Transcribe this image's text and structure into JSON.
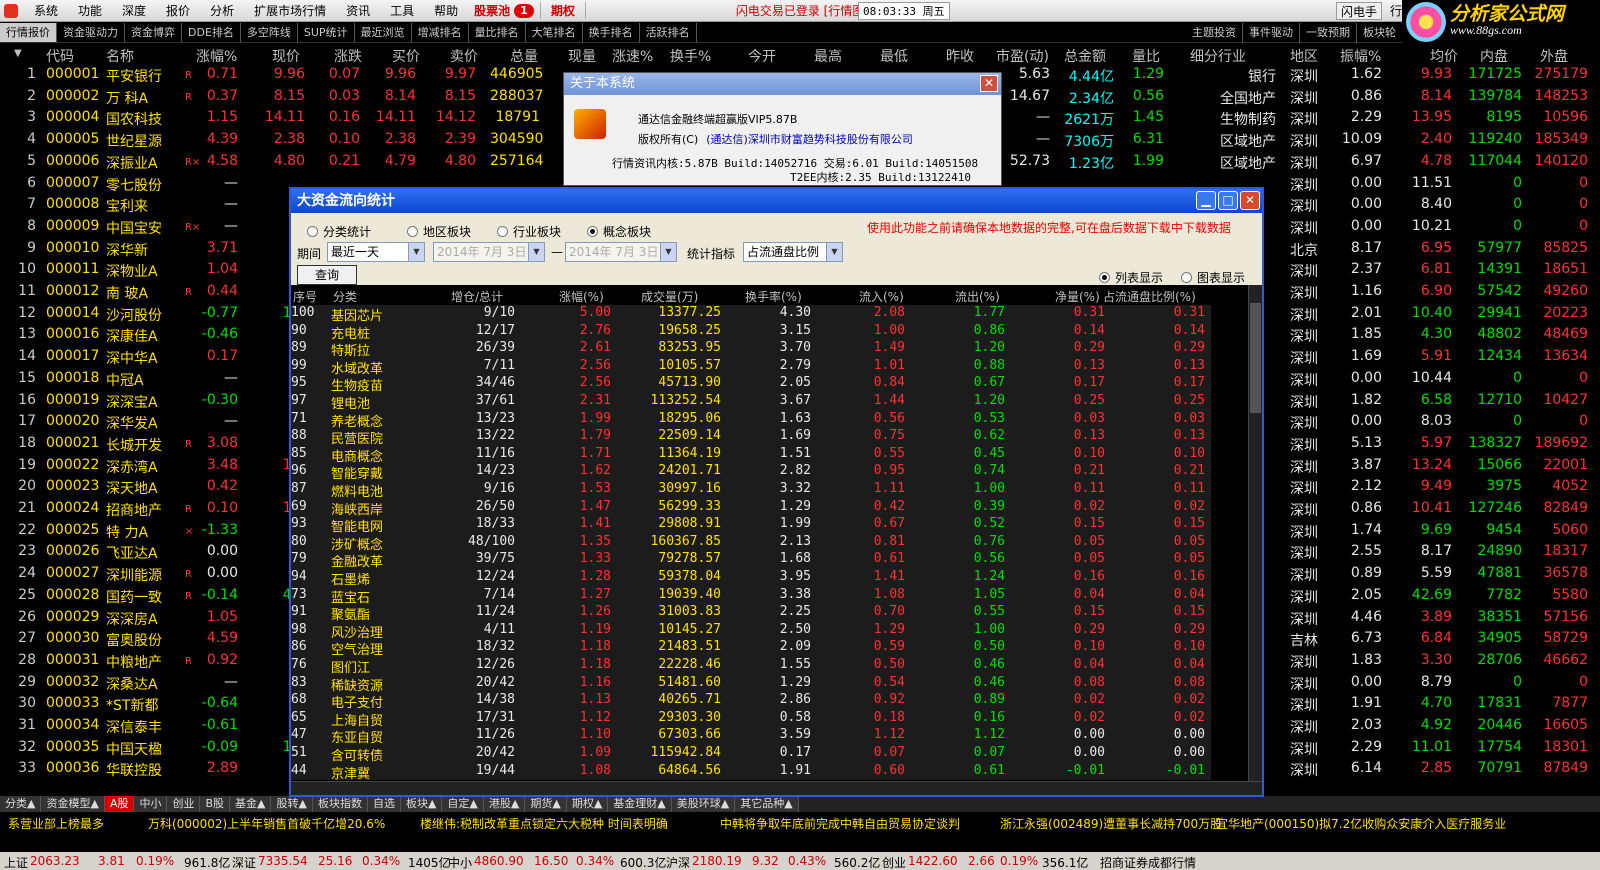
{
  "menubar": {
    "items": [
      "系统",
      "功能",
      "深度",
      "报价",
      "分析",
      "扩展市场行情",
      "资讯",
      "工具",
      "帮助"
    ],
    "pool": "股票池",
    "pool_badge": "1",
    "period": "期权",
    "status": "闪电交易已登录  [行情图-深沪A股]",
    "time": "08:03:33 周五",
    "flash": "闪电手",
    "extra": "行"
  },
  "logo": {
    "text": "分析家公式网",
    "url": "www.88gs.com"
  },
  "tabs": [
    "行情报价",
    "资金驱动力",
    "资金博弈",
    "DDE排名",
    "多空阵线",
    "SUP统计",
    "最近浏览",
    "增减排名",
    "量比排名",
    "大笔排名",
    "换手排名",
    "活跃排名"
  ],
  "tabs_right": [
    "主题投资",
    "事件驱动",
    "一致预期",
    "板块轮"
  ],
  "header": [
    "代码",
    "名称",
    "涨幅%",
    "现价",
    "涨跌",
    "买价",
    "卖价",
    "总量",
    "现量",
    "涨速%",
    "换手%",
    "今开",
    "最高",
    "最低",
    "昨收",
    "市盈(动)",
    "总金额",
    "量比",
    "细分行业",
    "地区",
    "振幅%",
    "均价",
    "内盘",
    "外盘"
  ],
  "rows": [
    {
      "i": "1",
      "code": "000001",
      "name": "平安银行",
      "m": "R",
      "chg": "0.71",
      "price": "9.96",
      "d": "0.07",
      "bid": "9.96",
      "ask": "9.97",
      "vol": "446905",
      "pe": "5.63",
      "amt": "4.44亿",
      "qr": "1.29",
      "ind": "银行",
      "reg": "深圳",
      "amp": "1.62",
      "avg": "9.93",
      "inv": "171725",
      "outv": "275179"
    },
    {
      "i": "2",
      "code": "000002",
      "name": "万  科A",
      "m": "R",
      "chg": "0.37",
      "price": "8.15",
      "d": "0.03",
      "bid": "8.14",
      "ask": "8.15",
      "vol": "288037",
      "pe": "14.67",
      "amt": "2.34亿",
      "qr": "0.56",
      "ind": "全国地产",
      "reg": "深圳",
      "amp": "0.86",
      "avg": "8.14",
      "inv": "139784",
      "outv": "148253"
    },
    {
      "i": "3",
      "code": "000004",
      "name": "国农科技",
      "m": "",
      "chg": "1.15",
      "price": "14.11",
      "d": "0.16",
      "bid": "14.11",
      "ask": "14.12",
      "vol": "18791",
      "pe": "—",
      "amt": "2621万",
      "qr": "1.45",
      "ind": "生物制药",
      "reg": "深圳",
      "amp": "2.29",
      "avg": "13.95",
      "inv": "8195",
      "outv": "10596"
    },
    {
      "i": "4",
      "code": "000005",
      "name": "世纪星源",
      "m": "",
      "chg": "4.39",
      "price": "2.38",
      "d": "0.10",
      "bid": "2.38",
      "ask": "2.39",
      "vol": "304590",
      "pe": "—",
      "amt": "7306万",
      "qr": "6.31",
      "ind": "区域地产",
      "reg": "深圳",
      "amp": "10.09",
      "avg": "2.40",
      "inv": "119240",
      "outv": "185349"
    },
    {
      "i": "5",
      "code": "000006",
      "name": "深振业A",
      "m": "R×",
      "chg": "4.58",
      "price": "4.80",
      "d": "0.21",
      "bid": "4.79",
      "ask": "4.80",
      "vol": "257164",
      "pe": "52.73",
      "amt": "1.23亿",
      "qr": "1.99",
      "ind": "区域地产",
      "reg": "深圳",
      "amp": "6.97",
      "avg": "4.78",
      "inv": "117044",
      "outv": "140120"
    },
    {
      "i": "6",
      "code": "000007",
      "name": "零七股份",
      "m": "",
      "chg": "—",
      "price": "",
      "d": "",
      "bid": "",
      "ask": "",
      "vol": "",
      "pe": "",
      "amt": "",
      "qr": "",
      "ind": "",
      "reg": "深圳",
      "amp": "0.00",
      "avg": "11.51",
      "inv": "0",
      "outv": "0"
    },
    {
      "i": "7",
      "code": "000008",
      "name": "宝利来",
      "m": "",
      "chg": "—",
      "price": "",
      "d": "",
      "bid": "",
      "ask": "",
      "vol": "",
      "pe": "",
      "amt": "",
      "qr": "",
      "ind": "",
      "reg": "深圳",
      "amp": "0.00",
      "avg": "8.40",
      "inv": "0",
      "outv": "0"
    },
    {
      "i": "8",
      "code": "000009",
      "name": "中国宝安",
      "m": "R×",
      "chg": "—",
      "price": "",
      "d": "",
      "bid": "",
      "ask": "",
      "vol": "",
      "pe": "",
      "amt": "",
      "qr": "",
      "ind": "",
      "reg": "深圳",
      "amp": "0.00",
      "avg": "10.21",
      "inv": "0",
      "outv": "0"
    },
    {
      "i": "9",
      "code": "000010",
      "name": "深华新",
      "m": "",
      "chg": "3.71",
      "price": "6.",
      "d": "",
      "bid": "",
      "ask": "",
      "vol": "",
      "pe": "",
      "amt": "",
      "qr": "",
      "ind": "",
      "reg": "北京",
      "amp": "8.17",
      "avg": "6.95",
      "inv": "57977",
      "outv": "85825"
    },
    {
      "i": "10",
      "code": "000011",
      "name": "深物业A",
      "m": "",
      "chg": "1.04",
      "price": "6.",
      "d": "",
      "bid": "",
      "ask": "",
      "vol": "",
      "pe": "",
      "amt": "",
      "qr": "",
      "ind": "",
      "reg": "深圳",
      "amp": "2.37",
      "avg": "6.81",
      "inv": "14391",
      "outv": "18651"
    },
    {
      "i": "11",
      "code": "000012",
      "name": "南  玻A",
      "m": "R",
      "chg": "0.44",
      "price": "6.",
      "d": "",
      "bid": "",
      "ask": "",
      "vol": "",
      "pe": "",
      "amt": "",
      "qr": "",
      "ind": "",
      "reg": "深圳",
      "amp": "1.16",
      "avg": "6.90",
      "inv": "57542",
      "outv": "49260"
    },
    {
      "i": "12",
      "code": "000014",
      "name": "沙河股份",
      "m": "",
      "chg": "-0.77",
      "price": "10.",
      "d": "",
      "bid": "",
      "ask": "",
      "vol": "",
      "pe": "",
      "amt": "",
      "qr": "",
      "ind": "",
      "reg": "深圳",
      "amp": "2.01",
      "avg": "10.40",
      "inv": "29941",
      "outv": "20223"
    },
    {
      "i": "13",
      "code": "000016",
      "name": "深康佳A",
      "m": "",
      "chg": "-0.46",
      "price": "4.",
      "d": "",
      "bid": "",
      "ask": "",
      "vol": "",
      "pe": "",
      "amt": "",
      "qr": "",
      "ind": "",
      "reg": "深圳",
      "amp": "1.85",
      "avg": "4.30",
      "inv": "48802",
      "outv": "48469"
    },
    {
      "i": "14",
      "code": "000017",
      "name": "深中华A",
      "m": "",
      "chg": "0.17",
      "price": "5.",
      "d": "",
      "bid": "",
      "ask": "",
      "vol": "",
      "pe": "",
      "amt": "",
      "qr": "",
      "ind": "",
      "reg": "深圳",
      "amp": "1.69",
      "avg": "5.91",
      "inv": "12434",
      "outv": "13634"
    },
    {
      "i": "15",
      "code": "000018",
      "name": "中冠A",
      "m": "",
      "chg": "—",
      "price": "",
      "d": "",
      "bid": "",
      "ask": "",
      "vol": "",
      "pe": "",
      "amt": "",
      "qr": "",
      "ind": "",
      "reg": "深圳",
      "amp": "0.00",
      "avg": "10.44",
      "inv": "0",
      "outv": "0"
    },
    {
      "i": "16",
      "code": "000019",
      "name": "深深宝A",
      "m": "",
      "chg": "-0.30",
      "price": "6.",
      "d": "",
      "bid": "",
      "ask": "",
      "vol": "",
      "pe": "",
      "amt": "",
      "qr": "",
      "ind": "",
      "reg": "深圳",
      "amp": "1.82",
      "avg": "6.58",
      "inv": "12710",
      "outv": "10427"
    },
    {
      "i": "17",
      "code": "000020",
      "name": "深华发A",
      "m": "",
      "chg": "—",
      "price": "",
      "d": "",
      "bid": "",
      "ask": "",
      "vol": "",
      "pe": "",
      "amt": "",
      "qr": "",
      "ind": "",
      "reg": "深圳",
      "amp": "0.00",
      "avg": "8.03",
      "inv": "0",
      "outv": "0"
    },
    {
      "i": "18",
      "code": "000021",
      "name": "长城开发",
      "m": "R",
      "chg": "3.08",
      "price": "6.",
      "d": "",
      "bid": "",
      "ask": "",
      "vol": "",
      "pe": "",
      "amt": "",
      "qr": "",
      "ind": "",
      "reg": "深圳",
      "amp": "5.13",
      "avg": "5.97",
      "inv": "138327",
      "outv": "189692"
    },
    {
      "i": "19",
      "code": "000022",
      "name": "深赤湾A",
      "m": "",
      "chg": "3.48",
      "price": "13.",
      "d": "",
      "bid": "",
      "ask": "",
      "vol": "",
      "pe": "",
      "amt": "",
      "qr": "",
      "ind": "",
      "reg": "深圳",
      "amp": "3.87",
      "avg": "13.24",
      "inv": "15066",
      "outv": "22001"
    },
    {
      "i": "20",
      "code": "000023",
      "name": "深天地A",
      "m": "",
      "chg": "0.42",
      "price": "9.",
      "d": "",
      "bid": "",
      "ask": "",
      "vol": "",
      "pe": "",
      "amt": "",
      "qr": "",
      "ind": "",
      "reg": "深圳",
      "amp": "2.12",
      "avg": "9.49",
      "inv": "3975",
      "outv": "4052"
    },
    {
      "i": "21",
      "code": "000024",
      "name": "招商地产",
      "m": "R",
      "chg": "0.10",
      "price": "10.",
      "d": "",
      "bid": "",
      "ask": "",
      "vol": "",
      "pe": "",
      "amt": "",
      "qr": "",
      "ind": "",
      "reg": "深圳",
      "amp": "0.86",
      "avg": "10.41",
      "inv": "127246",
      "outv": "82849"
    },
    {
      "i": "22",
      "code": "000025",
      "name": "特  力A",
      "m": "×",
      "chg": "-1.33",
      "price": "9.",
      "d": "",
      "bid": "",
      "ask": "",
      "vol": "",
      "pe": "",
      "amt": "",
      "qr": "",
      "ind": "",
      "reg": "深圳",
      "amp": "1.74",
      "avg": "9.69",
      "inv": "9454",
      "outv": "5060"
    },
    {
      "i": "23",
      "code": "000026",
      "name": "飞亚达A",
      "m": "",
      "chg": "0.00",
      "price": "8.",
      "d": "",
      "bid": "",
      "ask": "",
      "vol": "",
      "pe": "",
      "amt": "",
      "qr": "",
      "ind": "",
      "reg": "深圳",
      "amp": "2.55",
      "avg": "8.17",
      "inv": "24890",
      "outv": "18317"
    },
    {
      "i": "24",
      "code": "000027",
      "name": "深圳能源",
      "m": "R",
      "chg": "0.00",
      "price": "5.",
      "d": "",
      "bid": "",
      "ask": "",
      "vol": "",
      "pe": "",
      "amt": "",
      "qr": "",
      "ind": "",
      "reg": "深圳",
      "amp": "0.89",
      "avg": "5.59",
      "inv": "47881",
      "outv": "36578"
    },
    {
      "i": "25",
      "code": "000028",
      "name": "国药一致",
      "m": "R",
      "chg": "-0.14",
      "price": "42.",
      "d": "",
      "bid": "",
      "ask": "",
      "vol": "",
      "pe": "",
      "amt": "",
      "qr": "",
      "ind": "",
      "reg": "深圳",
      "amp": "2.05",
      "avg": "42.69",
      "inv": "7782",
      "outv": "5580"
    },
    {
      "i": "26",
      "code": "000029",
      "name": "深深房A",
      "m": "",
      "chg": "1.05",
      "price": "3.",
      "d": "",
      "bid": "",
      "ask": "",
      "vol": "",
      "pe": "",
      "amt": "",
      "qr": "",
      "ind": "",
      "reg": "深圳",
      "amp": "4.46",
      "avg": "3.89",
      "inv": "38351",
      "outv": "57156"
    },
    {
      "i": "27",
      "code": "000030",
      "name": "富奥股份",
      "m": "",
      "chg": "4.59",
      "price": "6.",
      "d": "",
      "bid": "",
      "ask": "",
      "vol": "",
      "pe": "",
      "amt": "",
      "qr": "",
      "ind": "",
      "reg": "吉林",
      "amp": "6.73",
      "avg": "6.84",
      "inv": "34905",
      "outv": "58729"
    },
    {
      "i": "28",
      "code": "000031",
      "name": "中粮地产",
      "m": "R",
      "chg": "0.92",
      "price": "3.",
      "d": "",
      "bid": "",
      "ask": "",
      "vol": "",
      "pe": "",
      "amt": "",
      "qr": "",
      "ind": "",
      "reg": "深圳",
      "amp": "1.83",
      "avg": "3.30",
      "inv": "28706",
      "outv": "46662"
    },
    {
      "i": "29",
      "code": "000032",
      "name": "深桑达A",
      "m": "",
      "chg": "—",
      "price": "",
      "d": "",
      "bid": "",
      "ask": "",
      "vol": "",
      "pe": "",
      "amt": "",
      "qr": "",
      "ind": "",
      "reg": "深圳",
      "amp": "0.00",
      "avg": "8.79",
      "inv": "0",
      "outv": "0"
    },
    {
      "i": "30",
      "code": "000033",
      "name": "*ST新都",
      "m": "",
      "chg": "-0.64",
      "price": "4.",
      "d": "",
      "bid": "",
      "ask": "",
      "vol": "",
      "pe": "",
      "amt": "",
      "qr": "",
      "ind": "",
      "reg": "深圳",
      "amp": "1.91",
      "avg": "4.70",
      "inv": "17831",
      "outv": "7877"
    },
    {
      "i": "31",
      "code": "000034",
      "name": "深信泰丰",
      "m": "",
      "chg": "-0.61",
      "price": "4.",
      "d": "",
      "bid": "",
      "ask": "",
      "vol": "",
      "pe": "",
      "amt": "",
      "qr": "",
      "ind": "",
      "reg": "深圳",
      "amp": "2.03",
      "avg": "4.92",
      "inv": "20446",
      "outv": "16605"
    },
    {
      "i": "32",
      "code": "000035",
      "name": "中国天楹",
      "m": "",
      "chg": "-0.09",
      "price": "10.",
      "d": "",
      "bid": "",
      "ask": "",
      "vol": "",
      "pe": "",
      "amt": "",
      "qr": "",
      "ind": "",
      "reg": "深圳",
      "amp": "2.29",
      "avg": "11.01",
      "inv": "17754",
      "outv": "18301"
    },
    {
      "i": "33",
      "code": "000036",
      "name": "华联控股",
      "m": "",
      "chg": "2.89",
      "price": "2.",
      "d": "",
      "bid": "",
      "ask": "",
      "vol": "",
      "pe": "",
      "amt": "",
      "qr": "",
      "ind": "",
      "reg": "深圳",
      "amp": "6.14",
      "avg": "2.85",
      "inv": "70791",
      "outv": "87849"
    }
  ],
  "about": {
    "title": "关于本系统",
    "line1": "通达信金融终端超赢版VIP5.87B",
    "line2": "版权所有(C)",
    "company": "(通达信)深圳市财富趋势科技股份有限公司",
    "line3": "行情资讯内核:5.87B Build:14052716 交易:6.01 Build:14051508",
    "line4": "T2EE内核:2.35 Build:13122410"
  },
  "flow": {
    "title": "大资金流向统计",
    "radios": [
      "分类统计",
      "地区板块",
      "行业板块",
      "概念板块"
    ],
    "warn": "使用此功能之前请确保本地数据的完整,可在盘后数据下载中下载数据",
    "period_label": "期间",
    "period_value": "最近一天",
    "date1": "2014年 7月 3日",
    "date2": "2014年 7月 3日",
    "dash": "—",
    "stat_label": "统计指标",
    "stat_value": "占流通盘比例",
    "query": "查询",
    "view_list": "列表显示",
    "view_chart": "图表显示",
    "cols": [
      "序号",
      "分类",
      "增仓/总计",
      "涨幅(%)",
      "成交量(万)",
      "换手率(%)",
      "流入(%)",
      "流出(%)",
      "净量(%)",
      "占流通盘比例(%)"
    ],
    "rows": [
      [
        "100",
        "基因芯片",
        "9/10",
        "5.00",
        "13377.25",
        "4.30",
        "2.08",
        "1.77",
        "0.31",
        "0.31"
      ],
      [
        "90",
        "充电桩",
        "12/17",
        "2.76",
        "19658.25",
        "3.15",
        "1.00",
        "0.86",
        "0.14",
        "0.14"
      ],
      [
        "89",
        "特斯拉",
        "26/39",
        "2.61",
        "83253.95",
        "3.70",
        "1.49",
        "1.20",
        "0.29",
        "0.29"
      ],
      [
        "99",
        "水域改革",
        "7/11",
        "2.56",
        "10105.57",
        "2.79",
        "1.01",
        "0.88",
        "0.13",
        "0.13"
      ],
      [
        "95",
        "生物疫苗",
        "34/46",
        "2.56",
        "45713.90",
        "2.05",
        "0.84",
        "0.67",
        "0.17",
        "0.17"
      ],
      [
        "97",
        "锂电池",
        "37/61",
        "2.31",
        "113252.54",
        "3.67",
        "1.44",
        "1.20",
        "0.25",
        "0.25"
      ],
      [
        "71",
        "养老概念",
        "13/23",
        "1.99",
        "18295.06",
        "1.63",
        "0.56",
        "0.53",
        "0.03",
        "0.03"
      ],
      [
        "88",
        "民营医院",
        "13/22",
        "1.79",
        "22509.14",
        "1.69",
        "0.75",
        "0.62",
        "0.13",
        "0.13"
      ],
      [
        "85",
        "电商概念",
        "11/16",
        "1.71",
        "11364.19",
        "1.51",
        "0.55",
        "0.45",
        "0.10",
        "0.10"
      ],
      [
        "96",
        "智能穿戴",
        "14/23",
        "1.62",
        "24201.71",
        "2.82",
        "0.95",
        "0.74",
        "0.21",
        "0.21"
      ],
      [
        "87",
        "燃料电池",
        "9/16",
        "1.53",
        "30997.16",
        "3.32",
        "1.11",
        "1.00",
        "0.11",
        "0.11"
      ],
      [
        "69",
        "海峡西岸",
        "26/50",
        "1.47",
        "56299.33",
        "1.29",
        "0.42",
        "0.39",
        "0.02",
        "0.02"
      ],
      [
        "93",
        "智能电网",
        "18/33",
        "1.41",
        "29808.91",
        "1.99",
        "0.67",
        "0.52",
        "0.15",
        "0.15"
      ],
      [
        "80",
        "涉矿概念",
        "48/100",
        "1.35",
        "160367.85",
        "2.13",
        "0.81",
        "0.76",
        "0.05",
        "0.05"
      ],
      [
        "79",
        "金融改革",
        "39/75",
        "1.33",
        "79278.57",
        "1.68",
        "0.61",
        "0.56",
        "0.05",
        "0.05"
      ],
      [
        "94",
        "石墨烯",
        "12/24",
        "1.28",
        "59378.04",
        "3.95",
        "1.41",
        "1.24",
        "0.16",
        "0.16"
      ],
      [
        "73",
        "蓝宝石",
        "7/14",
        "1.27",
        "19039.40",
        "3.38",
        "1.08",
        "1.05",
        "0.04",
        "0.04"
      ],
      [
        "91",
        "聚氨酯",
        "11/24",
        "1.26",
        "31003.83",
        "2.25",
        "0.70",
        "0.55",
        "0.15",
        "0.15"
      ],
      [
        "98",
        "风沙治理",
        "4/11",
        "1.19",
        "10145.27",
        "2.50",
        "1.29",
        "1.00",
        "0.29",
        "0.29"
      ],
      [
        "86",
        "空气治理",
        "18/32",
        "1.18",
        "21483.51",
        "2.09",
        "0.59",
        "0.50",
        "0.10",
        "0.10"
      ],
      [
        "76",
        "图们江",
        "12/26",
        "1.18",
        "22228.46",
        "1.55",
        "0.50",
        "0.46",
        "0.04",
        "0.04"
      ],
      [
        "83",
        "稀缺资源",
        "20/42",
        "1.16",
        "51481.60",
        "1.29",
        "0.54",
        "0.46",
        "0.08",
        "0.08"
      ],
      [
        "68",
        "电子支付",
        "14/38",
        "1.13",
        "40265.71",
        "2.86",
        "0.92",
        "0.89",
        "0.02",
        "0.02"
      ],
      [
        "65",
        "上海自贸",
        "17/31",
        "1.12",
        "29303.30",
        "0.58",
        "0.18",
        "0.16",
        "0.02",
        "0.02"
      ],
      [
        "47",
        "东亚自贸",
        "11/26",
        "1.10",
        "67303.66",
        "3.59",
        "1.12",
        "1.12",
        "0.00",
        "0.00"
      ],
      [
        "51",
        "含可转债",
        "20/42",
        "1.09",
        "115942.84",
        "0.17",
        "0.07",
        "0.07",
        "0.00",
        "0.00"
      ],
      [
        "44",
        "京津冀",
        "19/44",
        "1.08",
        "64864.56",
        "1.91",
        "0.60",
        "0.61",
        "-0.01",
        "-0.01"
      ]
    ]
  },
  "bottom_tabs": [
    "分类▲",
    "资金模型▲",
    "A股",
    "中小",
    "创业",
    "B股",
    "基金▲",
    "股转▲",
    "板块指数",
    "自选",
    "板块▲",
    "自定▲",
    "港股▲",
    "期货▲",
    "期权▲",
    "基金理财▲",
    "美股环球▲",
    "其它品种▲"
  ],
  "ticker": [
    "系营业部上榜最多",
    "万科(000002)上半年销售首破千亿增20.6%",
    "楼继伟:税制改革重点锁定六大税种 时间表明确",
    "中韩将争取年底前完成中韩自由贸易协定谈判",
    "浙江永强(002489)遭董事长减持700万股",
    "宜华地产(000150)拟7.2亿收购众安康介入医疗服务业"
  ],
  "status": {
    "sh_label": "上证",
    "sh": "2063.23",
    "sh_d": "3.81",
    "sh_p": "0.19%",
    "sh_amt": "961.8亿",
    "sz_label": "深证",
    "sz": "7335.54",
    "sz_d": "25.16",
    "sz_p": "0.34%",
    "sz_amt": "1405亿",
    "zx_label": "中小",
    "zx": "4860.90",
    "zx_d": "16.50",
    "zx_p": "0.34%",
    "zx_amt": "600.3亿",
    "hs_label": "沪深",
    "hs": "2180.19",
    "hs_d": "9.32",
    "hs_p": "0.43%",
    "hs_amt": "560.2亿",
    "cy_label": "创业",
    "cy": "1422.60",
    "cy_d": "2.66",
    "cy_p": "0.19%",
    "cy_amt": "356.1亿",
    "broker": "招商证券成都行情"
  }
}
